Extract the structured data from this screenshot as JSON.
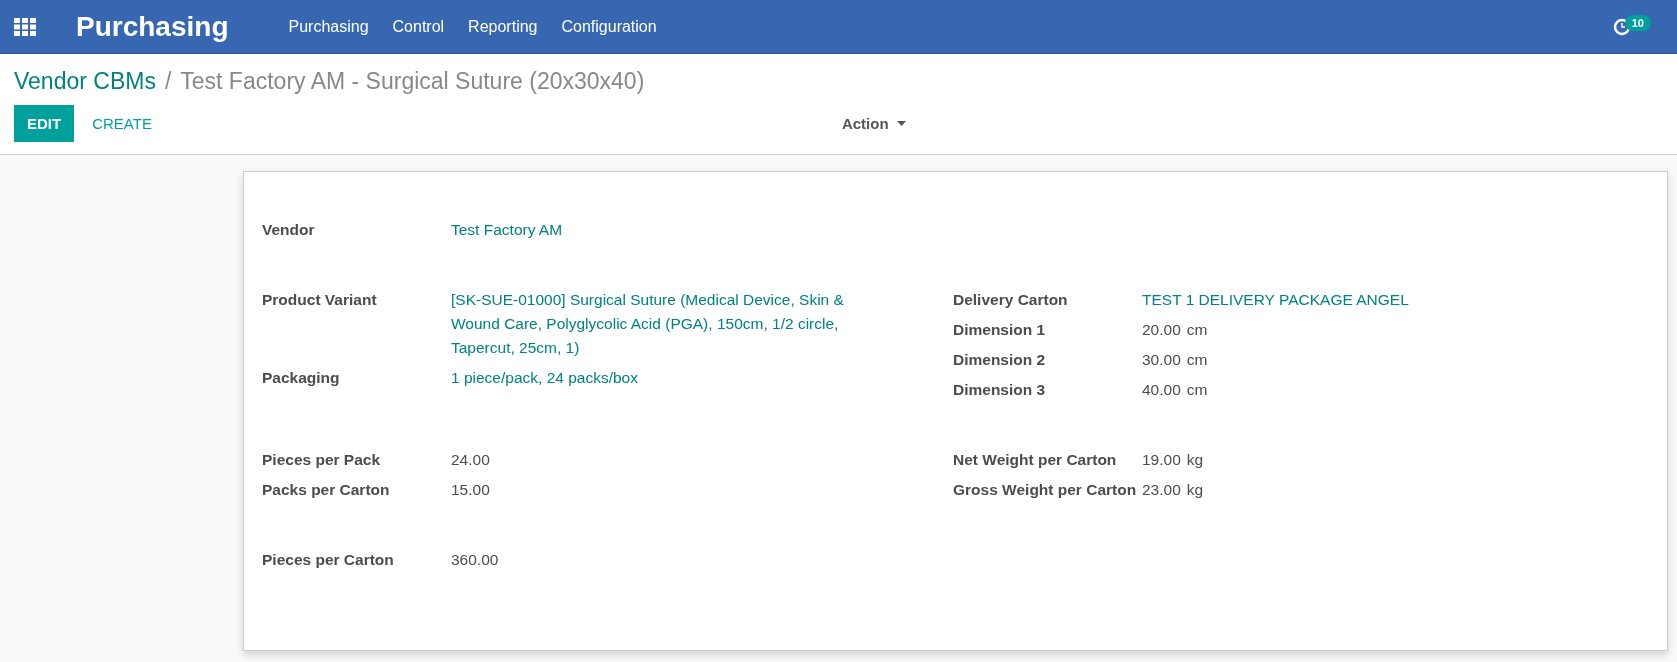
{
  "navbar": {
    "app_title": "Purchasing",
    "menu": [
      "Purchasing",
      "Control",
      "Reporting",
      "Configuration"
    ],
    "activity_count": "10"
  },
  "breadcrumb": {
    "parent": "Vendor CBMs",
    "separator": "/",
    "current": "Test Factory AM - Surgical Suture (20x30x40)"
  },
  "buttons": {
    "edit": "EDIT",
    "create": "CREATE",
    "action": "Action"
  },
  "groups": [
    {
      "left": [
        {
          "label": "Vendor",
          "value": "Test Factory AM",
          "kind": "link"
        }
      ]
    },
    {
      "left": [
        {
          "label": "Product Variant",
          "value": "[SK-SUE-01000] Surgical Suture (Medical Device, Skin & Wound Care, Polyglycolic Acid (PGA), 150cm, 1/2 circle, Tapercut, 25cm, 1)",
          "kind": "link"
        },
        {
          "label": "Packaging",
          "value": "1 piece/pack, 24 packs/box",
          "kind": "link"
        }
      ],
      "right": [
        {
          "label": "Delivery Carton",
          "value": "TEST 1 DELIVERY PACKAGE ANGEL",
          "kind": "link"
        },
        {
          "label": "Dimension 1",
          "value": "20.00",
          "unit": "cm",
          "kind": "plain"
        },
        {
          "label": "Dimension 2",
          "value": "30.00",
          "unit": "cm",
          "kind": "plain"
        },
        {
          "label": "Dimension 3",
          "value": "40.00",
          "unit": "cm",
          "kind": "plain"
        }
      ]
    },
    {
      "left": [
        {
          "label": "Pieces per Pack",
          "value": "24.00",
          "kind": "plain"
        },
        {
          "label": "Packs per Carton",
          "value": "15.00",
          "kind": "plain"
        }
      ],
      "right": [
        {
          "label": "Net Weight per Carton",
          "value": "19.00",
          "unit": "kg",
          "kind": "plain"
        },
        {
          "label": "Gross Weight per Carton",
          "value": "23.00",
          "unit": "kg",
          "kind": "plain"
        }
      ]
    },
    {
      "left": [
        {
          "label": "Pieces per Carton",
          "value": "360.00",
          "kind": "plain"
        }
      ]
    }
  ]
}
